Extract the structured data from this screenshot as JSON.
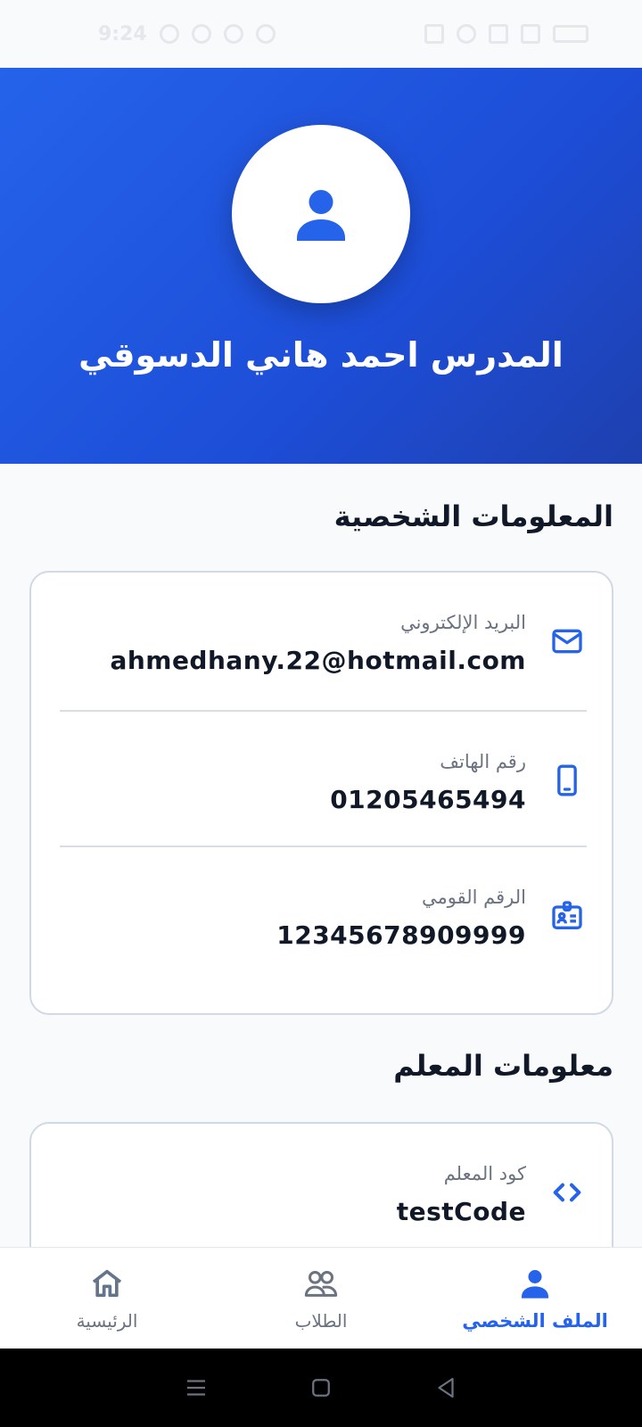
{
  "status_bar": {
    "time": "9:24"
  },
  "header": {
    "name": "المدرس احمد هاني الدسوقي"
  },
  "sections": {
    "personal_title": "المعلومات الشخصية",
    "teacher_title": "معلومات المعلم"
  },
  "personal_info": [
    {
      "icon": "email-icon",
      "label": "البريد الإلكتروني",
      "value": "ahmedhany.22@hotmail.com"
    },
    {
      "icon": "phone-icon",
      "label": "رقم الهاتف",
      "value": "01205465494"
    },
    {
      "icon": "id-card-icon",
      "label": "الرقم القومي",
      "value": "12345678909999"
    }
  ],
  "teacher_info": [
    {
      "icon": "code-icon",
      "label": "كود المعلم",
      "value": "testCode"
    }
  ],
  "bottom_nav": [
    {
      "icon": "person-icon",
      "label": "الملف الشخصي",
      "active": true
    },
    {
      "icon": "users-icon",
      "label": "الطلاب",
      "active": false
    },
    {
      "icon": "home-icon",
      "label": "الرئيسية",
      "active": false
    }
  ],
  "colors": {
    "accent": "#2563eb",
    "header_gradient_start": "#2563eb",
    "header_gradient_end": "#1e40af",
    "background": "#f8fafc",
    "muted_text": "#6b7280"
  }
}
